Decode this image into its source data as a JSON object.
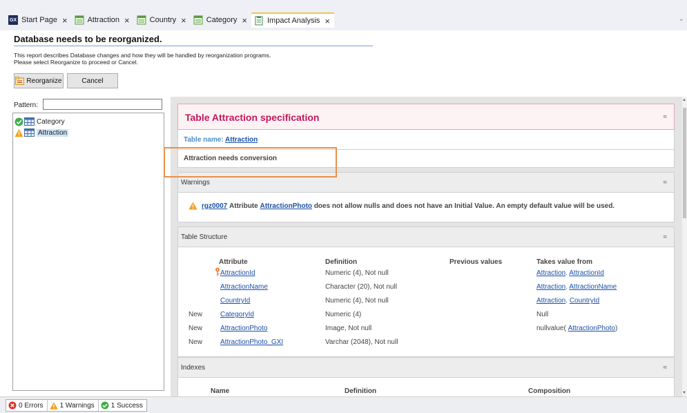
{
  "tabs": [
    {
      "label": "Start Page",
      "icon": "gx-logo-icon",
      "active": false
    },
    {
      "label": "Attraction",
      "icon": "transaction-icon",
      "active": false
    },
    {
      "label": "Country",
      "icon": "transaction-icon",
      "active": false
    },
    {
      "label": "Category",
      "icon": "transaction-icon",
      "active": false
    },
    {
      "label": "Impact Analysis",
      "icon": "impact-analysis-icon",
      "active": true
    }
  ],
  "header": {
    "title": "Database needs to be reorganized.",
    "description_line1": "This report describes Database changes and how they will be handled by reorganization programs.",
    "description_line2": "Please select Reorganize to proceed or Cancel."
  },
  "buttons": {
    "reorganize": "Reorganize",
    "cancel": "Cancel"
  },
  "pattern": {
    "label": "Pattern:",
    "value": ""
  },
  "tree": [
    {
      "label": "Category",
      "status": "success"
    },
    {
      "label": "Attraction",
      "status": "warning"
    }
  ],
  "report": {
    "spec_title": "Table Attraction specification",
    "table_name_label": "Table name:",
    "table_name_value": "Attraction",
    "conversion_note": "Attraction needs conversion",
    "warnings": {
      "title": "Warnings",
      "code": "rgz0007",
      "prefix": "Attribute",
      "attribute": "AttractionPhoto",
      "message": "does not allow nulls and does not have an Initial Value. An empty default value will be used."
    },
    "structure": {
      "title": "Table Structure",
      "columns": [
        "Attribute",
        "Definition",
        "Previous values",
        "Takes value from"
      ],
      "rows": [
        {
          "status": "",
          "key": true,
          "attribute": "AttractionId",
          "definition": "Numeric (4), Not null",
          "takes_kind": "link",
          "takes_a": "Attraction",
          "takes_b": "AttractionId"
        },
        {
          "status": "",
          "key": false,
          "attribute": "AttractionName",
          "definition": "Character (20), Not null",
          "takes_kind": "link",
          "takes_a": "Attraction",
          "takes_b": "AttractionName"
        },
        {
          "status": "",
          "key": false,
          "attribute": "CountryId",
          "definition": "Numeric (4), Not null",
          "takes_kind": "link",
          "takes_a": "Attraction",
          "takes_b": "CountryId"
        },
        {
          "status": "New",
          "key": false,
          "attribute": "CategoryId",
          "definition": "Numeric (4)",
          "takes_kind": "text",
          "takes_text": "Null"
        },
        {
          "status": "New",
          "key": false,
          "attribute": "AttractionPhoto",
          "definition": "Image, Not null",
          "takes_kind": "func",
          "takes_fn": "nullvalue(",
          "takes_arg": "AttractionPhoto",
          "takes_close": ")"
        },
        {
          "status": "New",
          "key": false,
          "attribute": "AttractionPhoto_GXI",
          "definition": "Varchar (2048), Not null",
          "takes_kind": "none"
        }
      ]
    },
    "indexes": {
      "title": "Indexes",
      "columns": [
        "Name",
        "Definition",
        "Composition"
      ]
    },
    "collapse_glyph": "≈"
  },
  "status": {
    "errors": "0 Errors",
    "warnings": "1 Warnings",
    "success": "1 Success"
  },
  "colors": {
    "spec_title": "#c2185b",
    "link": "#1a4fa8",
    "warning": "#f0a020",
    "success": "#3fae49",
    "error": "#d9342b",
    "highlight_box": "#e8904a"
  }
}
